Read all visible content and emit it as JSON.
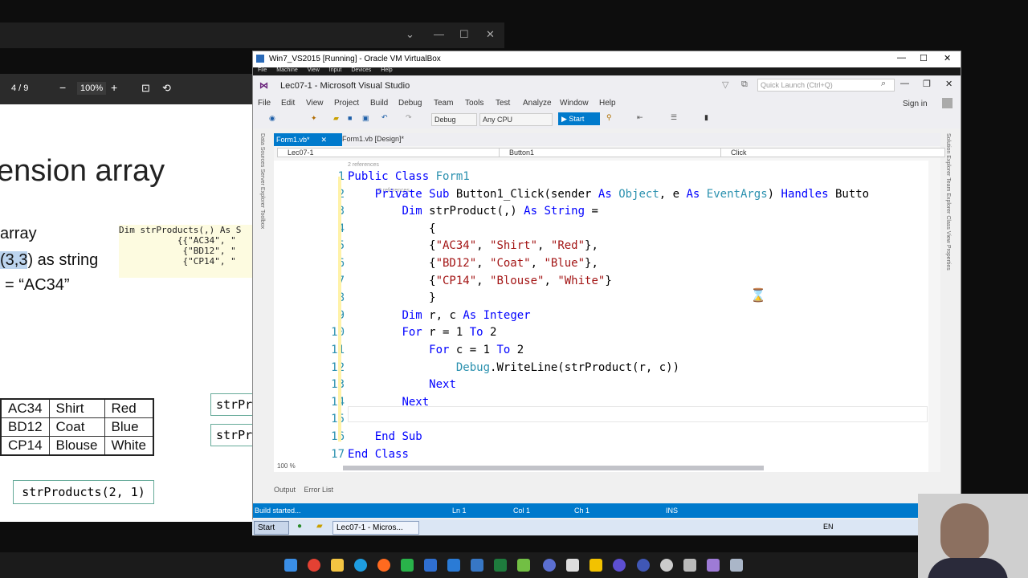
{
  "pdf": {
    "page_indicator": "4 / 9",
    "zoom": "100%",
    "slide_title": "ension array",
    "line1": "array",
    "line2_hl": "(3,3",
    "line2_rest": ") as string",
    "line3": "= “AC34”",
    "code_lines": "Dim strProducts(,) As S\n           {{\"AC34\", \"\n            {\"BD12\", \"\n            {\"CP14\", \"",
    "table": [
      [
        "AC34",
        "Shirt",
        "Red"
      ],
      [
        "BD12",
        "Coat",
        "Blue"
      ],
      [
        "CP14",
        "Blouse",
        "White"
      ]
    ],
    "str_box1": "strPr",
    "str_box2": "strPr",
    "index_box": "strProducts(2, 1)"
  },
  "vm": {
    "title": "Win7_VS2015 [Running] - Oracle VM VirtualBox",
    "menu": [
      "File",
      "Machine",
      "View",
      "Input",
      "Devices",
      "Help"
    ]
  },
  "vs": {
    "title": "Lec07-1 - Microsoft Visual Studio",
    "quick_launch": "Quick Launch (Ctrl+Q)",
    "menu": [
      "File",
      "Edit",
      "View",
      "Project",
      "Build",
      "Debug",
      "Team",
      "Tools",
      "Test",
      "Analyze",
      "Window",
      "Help"
    ],
    "sign_in": "Sign in",
    "config": "Debug",
    "platform": "Any CPU",
    "start": "Start",
    "tab_active": "Form1.vb*",
    "tab_inactive": "Form1.vb [Design]*",
    "nav_project": "Lec07-1",
    "nav_object": "Button1",
    "nav_event": "Click",
    "refs_class": "2 references",
    "refs_sub": "0 references",
    "zoom": "100 %",
    "lines": [
      {
        "n": "1",
        "text": "Public Class Form1"
      },
      {
        "n": "2",
        "text": "    Private Sub Button1_Click(sender As Object, e As EventArgs) Handles Butto"
      },
      {
        "n": "3",
        "text": "        Dim strProduct(,) As String ="
      },
      {
        "n": "4",
        "text": "            {"
      },
      {
        "n": "5",
        "text": "            {\"AC34\", \"Shirt\", \"Red\"},"
      },
      {
        "n": "6",
        "text": "            {\"BD12\", \"Coat\", \"Blue\"},"
      },
      {
        "n": "7",
        "text": "            {\"CP14\", \"Blouse\", \"White\"}"
      },
      {
        "n": "8",
        "text": "            }"
      },
      {
        "n": "9",
        "text": "        Dim r, c As Integer"
      },
      {
        "n": "10",
        "text": "        For r = 1 To 2"
      },
      {
        "n": "11",
        "text": "            For c = 1 To 2"
      },
      {
        "n": "12",
        "text": "                Debug.WriteLine(strProduct(r, c))"
      },
      {
        "n": "13",
        "text": "            Next"
      },
      {
        "n": "14",
        "text": "        Next"
      },
      {
        "n": "15",
        "text": ""
      },
      {
        "n": "16",
        "text": "    End Sub"
      },
      {
        "n": "17",
        "text": "End Class"
      }
    ],
    "bottom_tabs": [
      "Output",
      "Error List"
    ],
    "status": {
      "message": "Build started...",
      "ln": "Ln 1",
      "col": "Col 1",
      "ch": "Ch 1",
      "mode": "INS"
    },
    "side_panels": [
      "Solution Explorer",
      "Team Explorer",
      "Class View",
      "Properties"
    ],
    "left_panels": [
      "Data Sources",
      "Server Explorer",
      "Toolbox"
    ]
  },
  "guest_taskbar": {
    "start": "Start",
    "task": "Lec07-1 - Micros...",
    "lang": "EN"
  },
  "colors": {
    "vs_accent": "#007acc",
    "keyword": "#0000ff",
    "type": "#2b91af",
    "string": "#a31515"
  }
}
